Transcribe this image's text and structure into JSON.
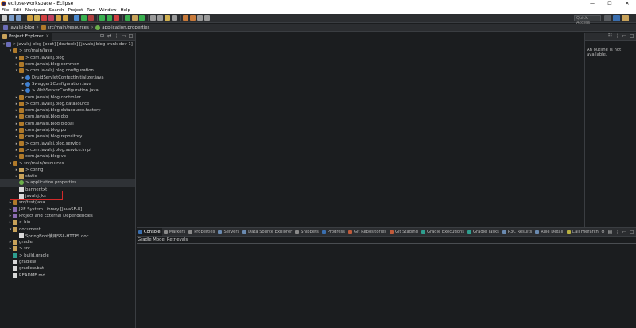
{
  "window": {
    "title": "eclipse-workspace - Eclipse",
    "controls": [
      "—",
      "☐",
      "✕"
    ]
  },
  "menu": [
    "File",
    "Edit",
    "Navigate",
    "Search",
    "Project",
    "Run",
    "Window",
    "Help"
  ],
  "toolbar": {
    "quick_access_placeholder": "Quick Access"
  },
  "breadcrumb": [
    "javalsj-blog",
    "src/main/resources",
    "application.properties"
  ],
  "project_explorer": {
    "tab_label": "Project Explorer",
    "close": "✕",
    "items": [
      {
        "label": "> javalsj-blog [boot] [devtools] [javalsj-blog trunk-dev-1]",
        "icon": "proj",
        "twisty": "▾",
        "indent": 0
      },
      {
        "label": "> src/main/java",
        "icon": "pkg",
        "twisty": "▾",
        "indent": 1
      },
      {
        "label": "> com.javalsj.blog",
        "icon": "pkg",
        "twisty": "▸",
        "indent": 2
      },
      {
        "label": "com.javalsj.blog.common",
        "icon": "pkg",
        "twisty": "▸",
        "indent": 2
      },
      {
        "label": "> com.javalsj.blog.configuration",
        "icon": "pkg",
        "twisty": "▾",
        "indent": 2
      },
      {
        "label": "DruidServletContextInitializer.java",
        "icon": "java",
        "twisty": "▸",
        "indent": 3
      },
      {
        "label": "Swagger2Configuration.java",
        "icon": "java",
        "twisty": "▸",
        "indent": 3
      },
      {
        "label": "> WebServerConfiguration.java",
        "icon": "java",
        "twisty": "▸",
        "indent": 3
      },
      {
        "label": "com.javalsj.blog.controller",
        "icon": "pkg",
        "twisty": "▸",
        "indent": 2
      },
      {
        "label": "> com.javalsj.blog.datasource",
        "icon": "pkg",
        "twisty": "▸",
        "indent": 2
      },
      {
        "label": "com.javalsj.blog.datasource.factory",
        "icon": "pkg",
        "twisty": "▸",
        "indent": 2
      },
      {
        "label": "com.javalsj.blog.dto",
        "icon": "pkg",
        "twisty": "▸",
        "indent": 2
      },
      {
        "label": "com.javalsj.blog.global",
        "icon": "pkg",
        "twisty": "▸",
        "indent": 2
      },
      {
        "label": "com.javalsj.blog.po",
        "icon": "pkg",
        "twisty": "▸",
        "indent": 2
      },
      {
        "label": "com.javalsj.blog.repository",
        "icon": "pkg",
        "twisty": "▸",
        "indent": 2
      },
      {
        "label": "> com.javalsj.blog.service",
        "icon": "pkg",
        "twisty": "▸",
        "indent": 2
      },
      {
        "label": "> com.javalsj.blog.service.impl",
        "icon": "pkg",
        "twisty": "▸",
        "indent": 2
      },
      {
        "label": "com.javalsj.blog.vo",
        "icon": "pkg",
        "twisty": "▸",
        "indent": 2
      },
      {
        "label": "> src/main/resources",
        "icon": "pkg",
        "twisty": "▾",
        "indent": 1
      },
      {
        "label": "> config",
        "icon": "folder",
        "twisty": "▸",
        "indent": 2
      },
      {
        "label": "static",
        "icon": "folder",
        "twisty": "▸",
        "indent": 2
      },
      {
        "label": "> application.properties",
        "icon": "leaf",
        "twisty": "",
        "indent": 2,
        "selected": true
      },
      {
        "label": "banner.txt",
        "icon": "file",
        "twisty": "",
        "indent": 2
      },
      {
        "label": "javalsj.jks",
        "icon": "file",
        "twisty": "",
        "indent": 2
      },
      {
        "label": "src/test/java",
        "icon": "pkg",
        "twisty": "▸",
        "indent": 1
      },
      {
        "label": "JRE System Library [JavaSE-8]",
        "icon": "lib",
        "twisty": "▸",
        "indent": 1
      },
      {
        "label": "Project and External Dependencies",
        "icon": "lib",
        "twisty": "▸",
        "indent": 1
      },
      {
        "label": "> bin",
        "icon": "folder",
        "twisty": "▸",
        "indent": 1
      },
      {
        "label": "document",
        "icon": "folder",
        "twisty": "▾",
        "indent": 1
      },
      {
        "label": "SpringBoot使用SSL-HTTPS.doc",
        "icon": "file",
        "twisty": "",
        "indent": 2
      },
      {
        "label": "gradle",
        "icon": "folder",
        "twisty": "▸",
        "indent": 1
      },
      {
        "label": "> src",
        "icon": "folder",
        "twisty": "▸",
        "indent": 1
      },
      {
        "label": "> build.gradle",
        "icon": "gradle",
        "twisty": "",
        "indent": 1
      },
      {
        "label": "gradlew",
        "icon": "file",
        "twisty": "",
        "indent": 1
      },
      {
        "label": "gradlew.bat",
        "icon": "file",
        "twisty": "",
        "indent": 1
      },
      {
        "label": "README.md",
        "icon": "file",
        "twisty": "",
        "indent": 1
      }
    ]
  },
  "outline": {
    "message": "An outline is not available."
  },
  "bottom_tabs": [
    {
      "label": "Console",
      "active": true,
      "color": "#3a6fb0"
    },
    {
      "label": "Markers",
      "color": "#8a8a8a"
    },
    {
      "label": "Properties",
      "color": "#8a8a8a"
    },
    {
      "label": "Servers",
      "color": "#6a8ab0"
    },
    {
      "label": "Data Source Explorer",
      "color": "#6a8ab0"
    },
    {
      "label": "Snippets",
      "color": "#8a8a8a"
    },
    {
      "label": "Progress",
      "color": "#3a6fb0"
    },
    {
      "label": "Git Repositories",
      "color": "#c05a3a"
    },
    {
      "label": "Git Staging",
      "color": "#c05a3a"
    },
    {
      "label": "Gradle Executions",
      "color": "#2e9e8e"
    },
    {
      "label": "Gradle Tasks",
      "color": "#2e9e8e"
    },
    {
      "label": "P3C Results",
      "color": "#6a8ab0"
    },
    {
      "label": "Rule Detail",
      "color": "#6a8ab0"
    },
    {
      "label": "Call Hierarchy",
      "color": "#b8b040"
    }
  ],
  "console": {
    "header": "Gradle Model Retrievals"
  },
  "colors": {
    "background": "#1b1d1f",
    "chrome": "#2b2d30",
    "selection_box": "#d22a2a"
  }
}
